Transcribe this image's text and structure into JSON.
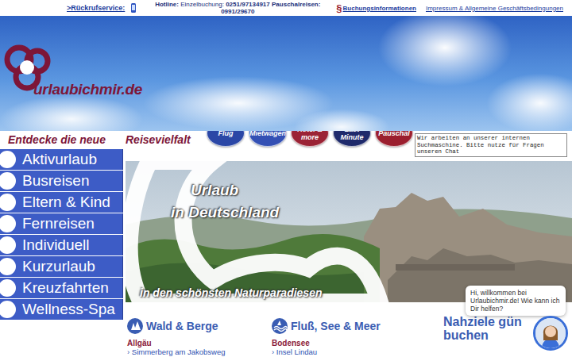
{
  "topbar": {
    "callback": ">Rückrufservice:",
    "hotline": {
      "label": "Hotline:",
      "single": "Einzelbuchung:",
      "single_number": "0251/97134917",
      "package": "Pauschalreisen:",
      "package_number": "0991/29670"
    },
    "booking_icon": "§",
    "booking_info": "Buchungsinformationen",
    "imprint": "Impressum & Allgemeine Geschäftsbedingungen"
  },
  "logo": {
    "text": "urlaubichmir.de"
  },
  "tagline": {
    "left": "Entdecke die neue",
    "right": "Reisevielfalt"
  },
  "nav_buttons": [
    {
      "label": "Flug",
      "color": "#2b47a6"
    },
    {
      "label": "Mietwagen",
      "color": "#3450b4"
    },
    {
      "label": "Hotel & more",
      "color": "#9b2335"
    },
    {
      "label": "Last Minute",
      "color": "#1f2a6b"
    },
    {
      "label": "Pauschal",
      "color": "#9b1f2f"
    }
  ],
  "search_notice": "Wir arbeiten an unserer internen Suchmaschine. Bitte nutze für Fragen unseren Chat",
  "sidebar": {
    "items": [
      "Aktivurlaub",
      "Busreisen",
      "Eltern & Kind",
      "Fernreisen",
      "Individuell",
      "Kurzurlaub",
      "Kreuzfahrten",
      "Wellness-Spa"
    ]
  },
  "banner": {
    "title_line1": "Urlaub",
    "title_line2": "in Deutschland",
    "subtitle": "in den schönsten Naturparadiesen"
  },
  "sections": [
    {
      "kind": "forest",
      "title": "Wald & Berge",
      "region": "Allgäu",
      "link": "› Simmerberg am Jakobsweg"
    },
    {
      "kind": "water",
      "title": "Fluß, See & Meer",
      "region": "Bodensee",
      "link": "› Insel Lindau"
    }
  ],
  "nearby": {
    "line1": "Nahziele gün",
    "line2": "buchen"
  },
  "chat": {
    "greeting": "Hi, willkommen bei Urlaubichmir.de! Wie kann ich Dir helfen?"
  }
}
